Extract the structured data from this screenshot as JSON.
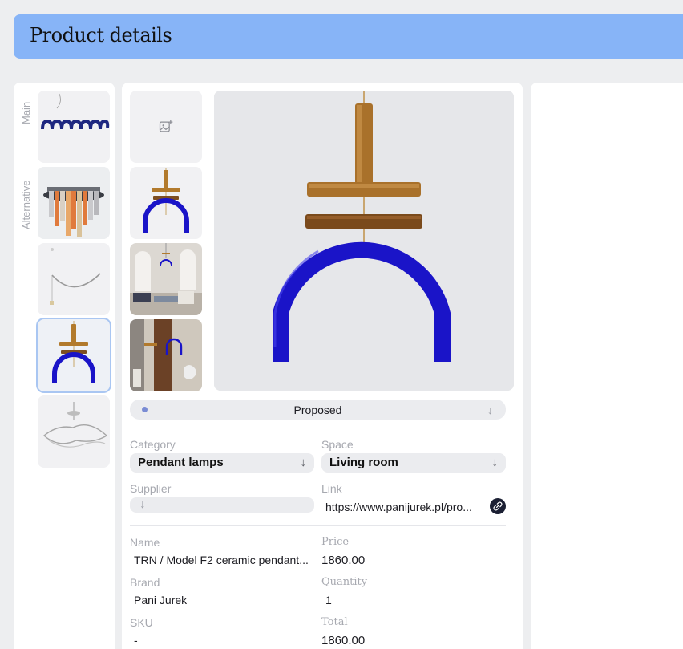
{
  "header": {
    "title": "Product details"
  },
  "gallery": {
    "tabs": [
      "Main",
      "Alternative"
    ],
    "selected_index": 3
  },
  "main": {
    "status": {
      "label": "Proposed"
    },
    "category": {
      "label": "Category",
      "value": "Pendant lamps"
    },
    "space": {
      "label": "Space",
      "value": "Living room"
    },
    "supplier": {
      "label": "Supplier",
      "value": ""
    },
    "link": {
      "label": "Link",
      "value": "https://www.panijurek.pl/pro..."
    },
    "name": {
      "label": "Name",
      "value": "TRN / Model F2 ceramic pendant..."
    },
    "price": {
      "label": "Price",
      "value": "1860.00"
    },
    "brand": {
      "label": "Brand",
      "value": "Pani Jurek"
    },
    "quantity": {
      "label": "Quantity",
      "value": "1"
    },
    "sku": {
      "label": "SKU",
      "value": "-"
    },
    "total": {
      "label": "Total",
      "value": "1860.00"
    }
  },
  "icons": {
    "add_image": "add-image-icon",
    "arrow_down": "arrow-down-icon",
    "link": "link-icon"
  },
  "colors": {
    "header_bg": "#87b4f7",
    "lamp_blue": "#1a14c8",
    "lamp_brown": "#9a5a1a"
  }
}
